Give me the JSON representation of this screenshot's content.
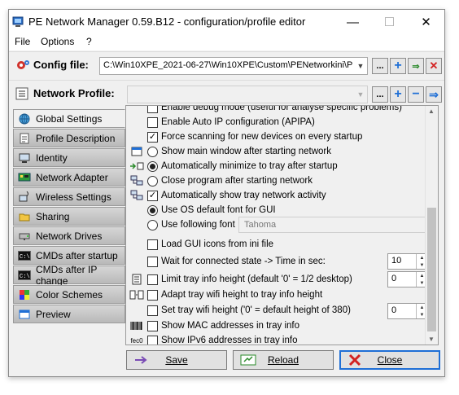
{
  "window": {
    "title": "PE Network Manager 0.59.B12 - configuration/profile editor",
    "min": "—",
    "max": "☐",
    "close": "✕"
  },
  "menu": [
    "File",
    "Options",
    "?"
  ],
  "config": {
    "label": "Config file:",
    "value": "C:\\Win10XPE_2021-06-27\\Win10XPE\\Custom\\PENetworkini\\P",
    "buttons": [
      "...",
      "+",
      "⇒",
      "✕"
    ]
  },
  "profile": {
    "label": "Network Profile:",
    "value": "",
    "buttons": [
      "...",
      "+",
      "−",
      "⇒"
    ]
  },
  "tabs": [
    {
      "label": "Global Settings",
      "icon": "globe-icon"
    },
    {
      "label": "Profile Description",
      "icon": "document-icon"
    },
    {
      "label": "Identity",
      "icon": "computer-icon"
    },
    {
      "label": "Network Adapter",
      "icon": "network-card-icon"
    },
    {
      "label": "Wireless Settings",
      "icon": "wireless-icon"
    },
    {
      "label": "Sharing",
      "icon": "folder-icon"
    },
    {
      "label": "Network Drives",
      "icon": "drive-icon"
    },
    {
      "label": "CMDs after startup",
      "icon": "cmd-icon"
    },
    {
      "label": "CMDs after IP change",
      "icon": "cmd-icon"
    },
    {
      "label": "Color Schemes",
      "icon": "palette-icon"
    },
    {
      "label": "Preview",
      "icon": "window-icon"
    }
  ],
  "settings": {
    "partial": "Enable debug mode (useful for analyse specific problems)",
    "apipa": "Enable Auto IP configuration (APIPA)",
    "force_scan": "Force scanning for new devices on every startup",
    "show_main": "Show main window after starting network",
    "auto_min": "Automatically minimize to tray after startup",
    "close_prog": "Close program after starting network",
    "tray_activity": "Automatically show tray network activity",
    "os_font": "Use OS default font for GUI",
    "following_font": "Use following font",
    "font_value": "Tahoma",
    "gui_icons": "Load GUI icons from ini file",
    "wait_connected": "Wait for connected state  -> Time in sec:",
    "wait_value": "10",
    "limit_tray": "Limit tray info height (default '0' = 1/2 desktop)",
    "limit_value": "0",
    "adapt_wifi": "Adapt tray wifi height to tray info height",
    "set_wifi": "Set tray wifi height ('0' = default height of 380)",
    "set_wifi_value": "0",
    "show_mac": "Show MAC addresses in tray info",
    "show_ipv6": "Show IPv6 addresses in tray info",
    "ipv6_icon_text": "fec0"
  },
  "buttons": {
    "save": "Save",
    "reload": "Reload",
    "close": "Close"
  },
  "colors": {
    "accent_blue": "#1f6fd6",
    "close_red": "#d32222",
    "save_purple": "#7a4bb5",
    "reload_green": "#2a8a2a"
  }
}
